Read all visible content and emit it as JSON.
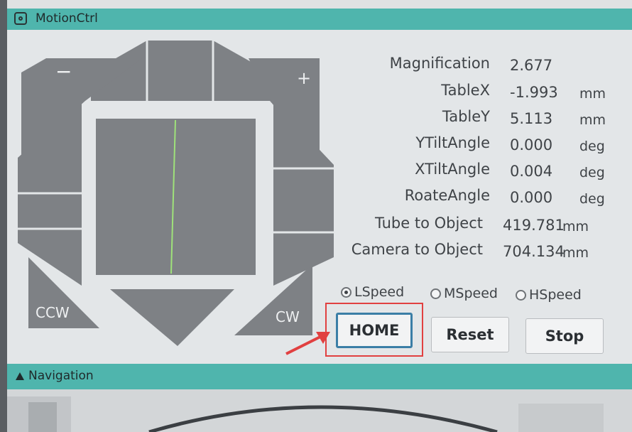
{
  "window": {
    "title": "MotionCtrl"
  },
  "joystick": {
    "minus_label": "−",
    "plus_label": "+",
    "ccw_label": "CCW",
    "cw_label": "CW"
  },
  "readouts": [
    {
      "label": "Magnification",
      "value": "2.677",
      "unit": ""
    },
    {
      "label": "TableX",
      "value": "-1.993",
      "unit": "mm"
    },
    {
      "label": "TableY",
      "value": "5.113",
      "unit": "mm"
    },
    {
      "label": "YTiltAngle",
      "value": "0.000",
      "unit": "deg"
    },
    {
      "label": "XTiltAngle",
      "value": "0.004",
      "unit": "deg"
    },
    {
      "label": "RoateAngle",
      "value": "0.000",
      "unit": "deg"
    },
    {
      "label": "Tube to Object",
      "value": "419.781",
      "unit": "mm"
    },
    {
      "label": "Camera to Object",
      "value": "704.134",
      "unit": "mm"
    }
  ],
  "speed": {
    "options": [
      "LSpeed",
      "MSpeed",
      "HSpeed"
    ],
    "selected": "LSpeed"
  },
  "buttons": {
    "home": "HOME",
    "reset": "Reset",
    "stop": "Stop"
  },
  "navigation": {
    "title": "Navigation"
  },
  "colors": {
    "header": "#4fb5ad",
    "panel": "#e3e6e8",
    "pad": "#7e8185",
    "highlight": "#e14040",
    "focus": "#3b7ea6"
  }
}
